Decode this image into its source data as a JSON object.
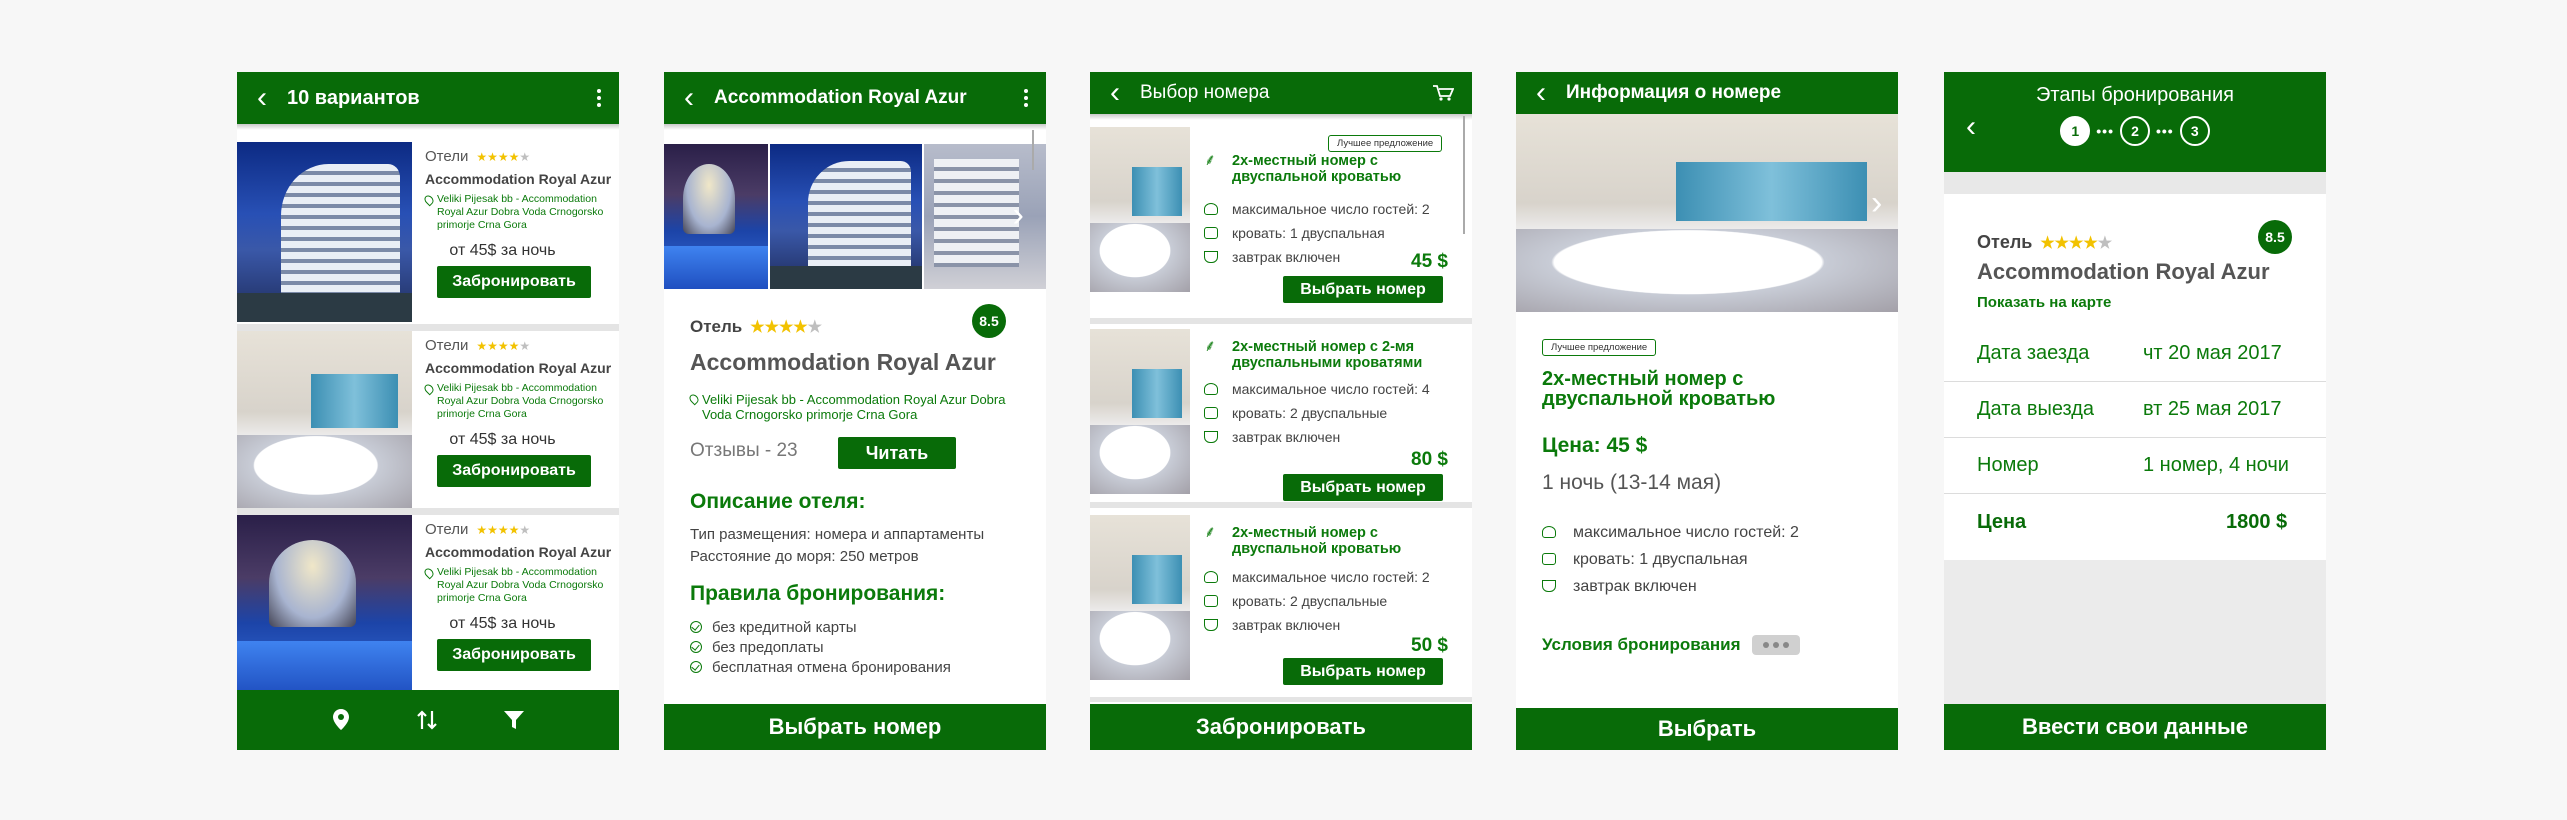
{
  "screen1": {
    "title": "10 вариантов",
    "cards": [
      {
        "category": "Отели",
        "name": "Accommodation Royal Azur",
        "address": "Veliki Pijesak bb - Accommodation Royal Azur Dobra Voda Crnogorsko primorje Crna Gora",
        "price": "от 45$ за ночь",
        "button": "Забронировать",
        "stars": 4
      },
      {
        "category": "Отели",
        "name": "Accommodation Royal Azur",
        "address": "Veliki Pijesak bb - Accommodation Royal Azur Dobra Voda Crnogorsko primorje Crna Gora",
        "price": "от 45$ за ночь",
        "button": "Забронировать",
        "stars": 4
      },
      {
        "category": "Отели",
        "name": "Accommodation Royal Azur",
        "address": "Veliki Pijesak bb - Accommodation Royal Azur Dobra Voda Crnogorsko primorje Crna Gora",
        "price": "от 45$ за ночь",
        "button": "Забронировать",
        "stars": 4
      }
    ],
    "bottom_icons": [
      "map-pin-icon",
      "sort-icon",
      "filter-icon"
    ]
  },
  "screen2": {
    "title": "Accommodation Royal Azur",
    "category": "Отель",
    "stars": 4,
    "rating": "8.5",
    "hotel_name": "Accommodation Royal Azur",
    "address": "Veliki Pijesak bb - Accommodation Royal Azur Dobra Voda Crnogorsko primorje Crna Gora",
    "reviews": "Отзывы - 23",
    "read_button": "Читать",
    "description_title": "Описание отеля:",
    "description_lines": [
      "Тип размещения: номера и аппартаменты",
      "Расстояние до моря: 250 метров"
    ],
    "rules_title": "Правила бронирования:",
    "rules": [
      "без кредитной карты",
      "без предоплаты",
      "бесплатная отмена бронирования"
    ],
    "bottom_button": "Выбрать номер"
  },
  "screen3": {
    "title": "Выбор номера",
    "best_offer": "Лучшее предложение",
    "rooms": [
      {
        "name": "2х-местный номер с двуспальной кроватью",
        "guests": "максимальное число гостей: 2",
        "bed": "кровать: 1 двуспальная",
        "breakfast": "завтрак включен",
        "price": "45 $",
        "button": "Выбрать номер"
      },
      {
        "name": "2х-местный номер с 2-мя двуспальными кроватями",
        "guests": "максимальное число гостей: 4",
        "bed": "кровать: 2 двуспальные",
        "breakfast": "завтрак включен",
        "price": "80 $",
        "button": "Выбрать номер"
      },
      {
        "name": "2х-местный номер с двуспальной кроватью",
        "guests": "максимальное число гостей: 2",
        "bed": "кровать: 2 двуспальные",
        "breakfast": "завтрак включен",
        "price": "50 $",
        "button": "Выбрать номер"
      }
    ],
    "bottom_button": "Забронировать"
  },
  "screen4": {
    "title": "Информация о номере",
    "best_offer": "Лучшее предложение",
    "room_name": "2х-местный номер с двуспальной кроватью",
    "price": "Цена: 45 $",
    "nights": "1 ночь (13-14 мая)",
    "guests": "максимальное число гостей: 2",
    "bed": "кровать: 1 двуспальная",
    "breakfast": "завтрак включен",
    "conditions": "Условия бронирования",
    "bottom_button": "Выбрать"
  },
  "screen5": {
    "title": "Этапы бронирования",
    "steps": [
      "1",
      "2",
      "3"
    ],
    "category": "Отель",
    "stars": 4,
    "rating": "8.5",
    "hotel_name": "Accommodation Royal Azur",
    "map_link": "Показать на карте",
    "rows": [
      {
        "label": "Дата заезда",
        "value": "чт 20 мая 2017"
      },
      {
        "label": "Дата выезда",
        "value": "вт 25 мая 2017"
      },
      {
        "label": "Номер",
        "value": "1 номер, 4 ночи"
      },
      {
        "label": "Цена",
        "value": "1800 $"
      }
    ],
    "bottom_button": "Ввести свои данные"
  },
  "colors": {
    "brand_green": "#086b08",
    "star_yellow": "#f2c200",
    "background": "#f7f7f7"
  }
}
